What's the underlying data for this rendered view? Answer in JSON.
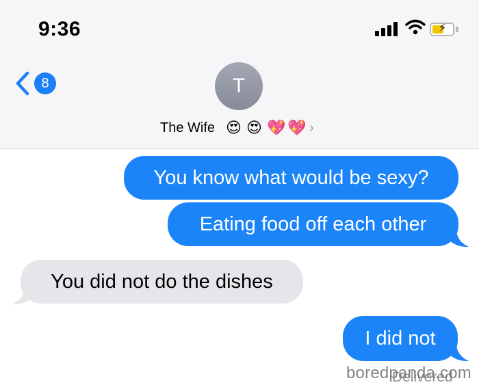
{
  "status_bar": {
    "time": "9:36"
  },
  "nav": {
    "back_count": "8"
  },
  "contact": {
    "initial": "T",
    "name": "The Wife",
    "emojis": [
      "😍",
      "😍",
      "💖",
      "💖"
    ],
    "chevron": "›"
  },
  "messages": [
    {
      "direction": "outgoing",
      "text": "You know what would be sexy?"
    },
    {
      "direction": "outgoing",
      "text": "Eating food off each other"
    },
    {
      "direction": "incoming",
      "text": "You did not do the dishes"
    },
    {
      "direction": "outgoing",
      "text": "I did not"
    }
  ],
  "footer": {
    "delivered": "Delivered",
    "watermark": "boredpanda.com"
  },
  "colors": {
    "outgoing_bubble": "#1b84f8",
    "incoming_bubble": "#e6e5ea",
    "badge": "#1b7ff5"
  }
}
